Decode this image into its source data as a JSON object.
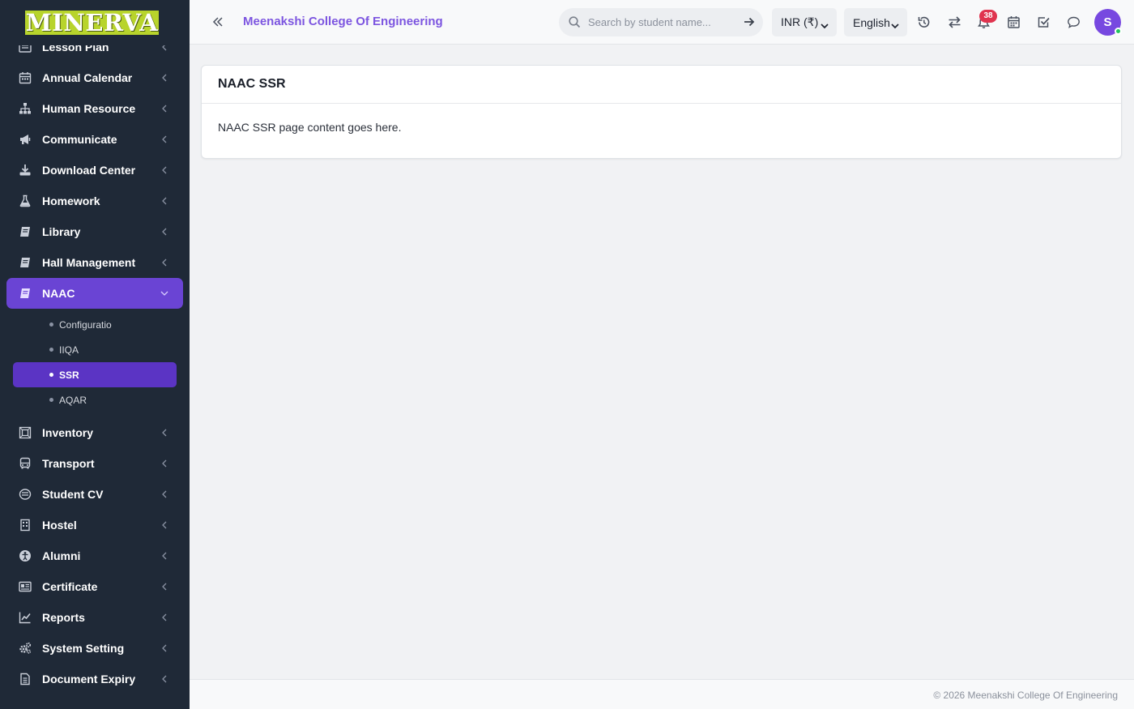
{
  "brand": {
    "logo_text": "MINERVA",
    "logo_color": "#b8d42c"
  },
  "sidebar": {
    "items": [
      {
        "label": "Lesson Plan",
        "icon": "list-icon"
      },
      {
        "label": "Annual Calendar",
        "icon": "calendar-icon"
      },
      {
        "label": "Human Resource",
        "icon": "sitemap-icon"
      },
      {
        "label": "Communicate",
        "icon": "bullhorn-icon"
      },
      {
        "label": "Download Center",
        "icon": "download-icon"
      },
      {
        "label": "Homework",
        "icon": "flask-icon"
      },
      {
        "label": "Library",
        "icon": "book-icon"
      },
      {
        "label": "Hall Management",
        "icon": "book-icon"
      },
      {
        "label": "NAAC",
        "icon": "book-icon",
        "active": true
      },
      {
        "label": "Inventory",
        "icon": "inventory-icon"
      },
      {
        "label": "Transport",
        "icon": "bus-icon"
      },
      {
        "label": "Student CV",
        "icon": "cv-icon"
      },
      {
        "label": "Hostel",
        "icon": "building-icon"
      },
      {
        "label": "Alumni",
        "icon": "alumni-icon"
      },
      {
        "label": "Certificate",
        "icon": "certificate-icon"
      },
      {
        "label": "Reports",
        "icon": "chart-line-icon"
      },
      {
        "label": "System Setting",
        "icon": "gears-icon"
      },
      {
        "label": "Document Expiry",
        "icon": "document-icon"
      }
    ],
    "naac_submenu": [
      {
        "label": "Configuratio"
      },
      {
        "label": "IIQA"
      },
      {
        "label": "SSR",
        "active": true
      },
      {
        "label": "AQAR"
      }
    ],
    "active_color": "#6a44d4"
  },
  "header": {
    "college_name": "Meenakshi College Of Engineering",
    "search_placeholder": "Search by student name...",
    "currency": "INR (₹)",
    "language": "English",
    "notification_count": "38",
    "avatar_initial": "S",
    "title_color": "#7c55e0"
  },
  "main": {
    "card_title": "NAAC SSR",
    "card_body": "NAAC SSR page content goes here."
  },
  "footer": {
    "text": "© 2026 Meenakshi College Of Engineering"
  }
}
